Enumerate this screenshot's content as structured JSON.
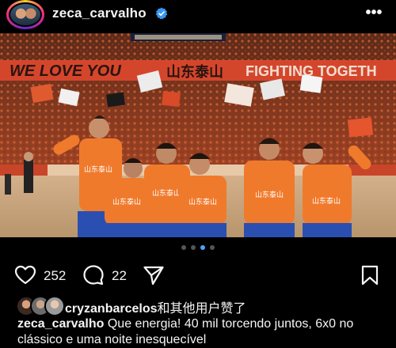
{
  "post": {
    "username": "zeca_carvalho",
    "verified_icon": "verified-badge-icon",
    "more_icon": "more-options-icon"
  },
  "photo": {
    "banner_left": "WE LOVE YOU",
    "banner_mid": "山东泰山",
    "banner_right": "FIGHTING TOGETH",
    "jersey_text": "山东泰山",
    "colors": {
      "jersey": "#f07a2c",
      "shorts": "#2b4fb0",
      "pitch": "#c8a878",
      "crowd": "#b4482a"
    }
  },
  "carousel": {
    "count": 4,
    "active_index": 2
  },
  "actions": {
    "likes": "252",
    "comments": "22",
    "icons": [
      "heart-icon",
      "comment-icon",
      "share-icon",
      "bookmark-icon"
    ]
  },
  "liked_by": {
    "user": "cryzanbarcelos",
    "suffix": "和其他用户赞了"
  },
  "caption": {
    "user": "zeca_carvalho",
    "text": "Que energia! 40 mil torcendo juntos, 6x0 no clássico e uma noite inesquecível"
  }
}
